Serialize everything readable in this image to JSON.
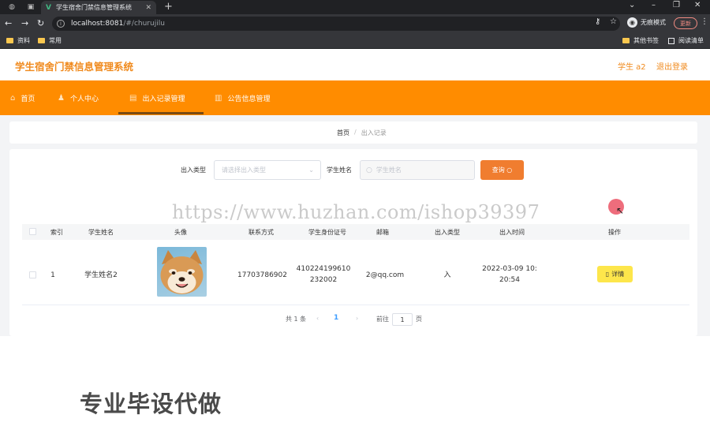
{
  "browser": {
    "tab_title": "学生宿舍门禁信息管理系统",
    "url_host": "localhost:8081",
    "url_path": "/#/churujilu",
    "incognito_label": "无痕模式",
    "update_label": "更新",
    "bookmarks": [
      "资料",
      "常用"
    ],
    "bookmarks_right": [
      "其他书签",
      "阅读清单"
    ]
  },
  "header": {
    "title": "学生宿舍门禁信息管理系统",
    "user": "学生 a2",
    "logout": "退出登录"
  },
  "nav": [
    {
      "label": "首页",
      "icon": "home-icon"
    },
    {
      "label": "个人中心",
      "icon": "person-icon"
    },
    {
      "label": "出入记录管理",
      "icon": "record-icon"
    },
    {
      "label": "公告信息管理",
      "icon": "chart-icon"
    }
  ],
  "breadcrumb": {
    "home": "首页",
    "sep": "/",
    "current": "出入记录"
  },
  "search": {
    "type_label": "出入类型",
    "type_placeholder": "请选择出入类型",
    "name_label": "学生姓名",
    "name_placeholder": "学生姓名",
    "query_label": "查询"
  },
  "table": {
    "headers": [
      "索引",
      "学生姓名",
      "头像",
      "联系方式",
      "学生身份证号",
      "邮箱",
      "出入类型",
      "出入时间",
      "操作"
    ],
    "rows": [
      {
        "index": "1",
        "name": "学生姓名2",
        "phone": "17703786902",
        "id_line1": "410224199610",
        "id_line2": "232002",
        "email": "2@qq.com",
        "type": "入",
        "time_line1": "2022-03-09 10:",
        "time_line2": "20:54",
        "action": "详情"
      }
    ]
  },
  "pagination": {
    "total": "共 1 条",
    "page": "1",
    "goto": "前往",
    "goto_value": "1",
    "page_suffix": "页"
  },
  "watermark": "https://www.huzhan.com/ishop39397",
  "banner": "专业毕设代做"
}
